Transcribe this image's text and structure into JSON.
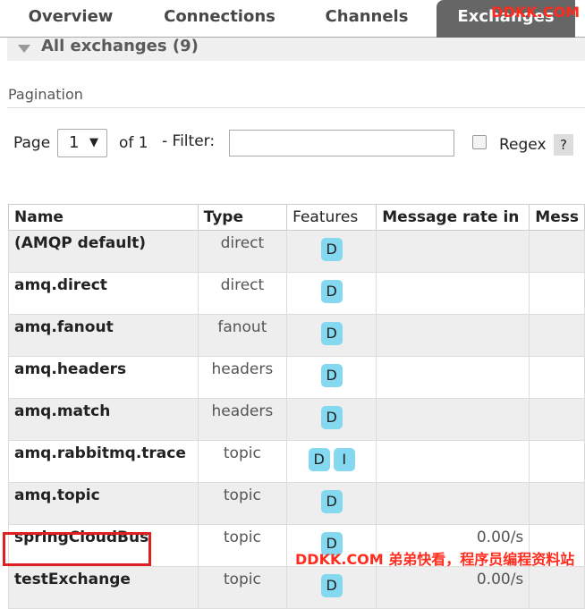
{
  "tabs": [
    {
      "label": "Overview"
    },
    {
      "label": "Connections"
    },
    {
      "label": "Channels"
    },
    {
      "label": "Exchanges"
    }
  ],
  "watermark_top": "DDKK.COM",
  "section_title": "All exchanges (9)",
  "pagination": {
    "heading": "Pagination",
    "page_label": "Page",
    "page_value": "1",
    "of_label": "of 1",
    "filter_label": "- Filter:",
    "filter_value": "",
    "regex_label": "Regex",
    "help_label": "?"
  },
  "table": {
    "headers": [
      "Name",
      "Type",
      "Features",
      "Message rate in",
      "Mess"
    ],
    "rows": [
      {
        "name": "(AMQP default)",
        "type": "direct",
        "features": [
          "D"
        ],
        "rate_in": ""
      },
      {
        "name": "amq.direct",
        "type": "direct",
        "features": [
          "D"
        ],
        "rate_in": ""
      },
      {
        "name": "amq.fanout",
        "type": "fanout",
        "features": [
          "D"
        ],
        "rate_in": ""
      },
      {
        "name": "amq.headers",
        "type": "headers",
        "features": [
          "D"
        ],
        "rate_in": ""
      },
      {
        "name": "amq.match",
        "type": "headers",
        "features": [
          "D"
        ],
        "rate_in": ""
      },
      {
        "name": "amq.rabbitmq.trace",
        "type": "topic",
        "features": [
          "D",
          "I"
        ],
        "rate_in": ""
      },
      {
        "name": "amq.topic",
        "type": "topic",
        "features": [
          "D"
        ],
        "rate_in": ""
      },
      {
        "name": "springCloudBus",
        "type": "topic",
        "features": [
          "D"
        ],
        "rate_in": "0.00/s"
      },
      {
        "name": "testExchange",
        "type": "topic",
        "features": [
          "D"
        ],
        "rate_in": "0.00/s"
      }
    ]
  },
  "watermark_bottom": "DDKK.COM 弟弟快看，程序员编程资料站",
  "colors": {
    "active_tab": "#666666",
    "feature_badge": "#84d8ef",
    "highlight": "#e02020",
    "watermark": "#ff2b1c"
  }
}
